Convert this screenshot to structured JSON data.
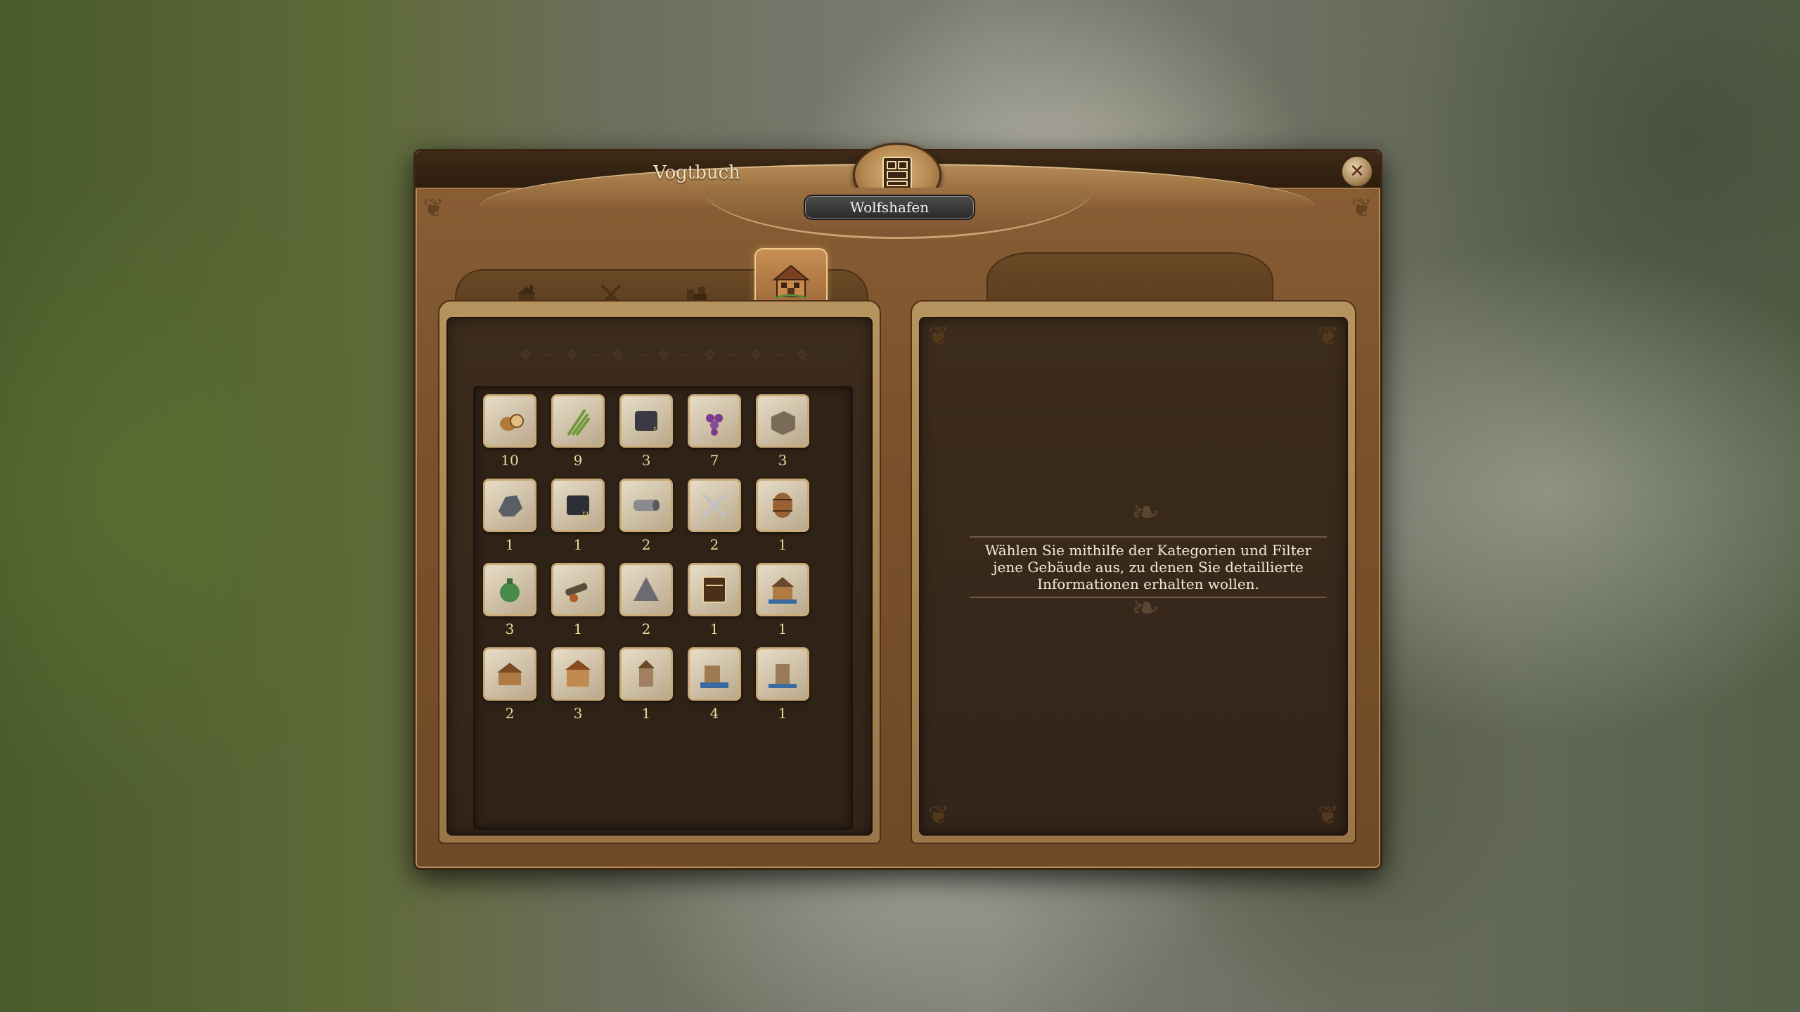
{
  "window": {
    "title": "Vogtbuch",
    "island": "Wolfshafen",
    "close_icon": "close-x-icon"
  },
  "tabs": [
    {
      "icon": "production-building-icon",
      "active": false
    },
    {
      "icon": "windmill-icon",
      "active": false
    },
    {
      "icon": "warehouse-icon",
      "active": false
    },
    {
      "icon": "residence-icon",
      "active": true
    }
  ],
  "goods": [
    {
      "icon": "wood-log-icon",
      "count": "10"
    },
    {
      "icon": "hemp-icon",
      "count": "9"
    },
    {
      "icon": "coal-1-icon",
      "count": "3"
    },
    {
      "icon": "grapes-icon",
      "count": "7"
    },
    {
      "icon": "stone-block-icon",
      "count": "3"
    },
    {
      "icon": "iron-ore-icon",
      "count": "1"
    },
    {
      "icon": "coal-2-icon",
      "count": "1"
    },
    {
      "icon": "iron-ingot-icon",
      "count": "2"
    },
    {
      "icon": "swords-icon",
      "count": "2"
    },
    {
      "icon": "barrel-icon",
      "count": "1"
    },
    {
      "icon": "wine-jug-icon",
      "count": "3"
    },
    {
      "icon": "cannon-icon",
      "count": "1"
    },
    {
      "icon": "tent-icon",
      "count": "2"
    },
    {
      "icon": "ledger-icon",
      "count": "1"
    },
    {
      "icon": "harbor-house-icon",
      "count": "1"
    },
    {
      "icon": "farmhouse-icon",
      "count": "2"
    },
    {
      "icon": "townhouse-icon",
      "count": "3"
    },
    {
      "icon": "chapel-icon",
      "count": "1"
    },
    {
      "icon": "dock-icon",
      "count": "4"
    },
    {
      "icon": "tower-icon",
      "count": "1"
    }
  ],
  "info": {
    "text": "Wählen Sie mithilfe der Kategorien und Filter jene Gebäude aus, zu denen Sie detaillierte Informationen erhalten wollen."
  },
  "colors": {
    "frame": "#7a512b",
    "panel_dark": "#3d2c1c",
    "count_text": "#f0d99a",
    "title_text": "#f1e2c0"
  }
}
